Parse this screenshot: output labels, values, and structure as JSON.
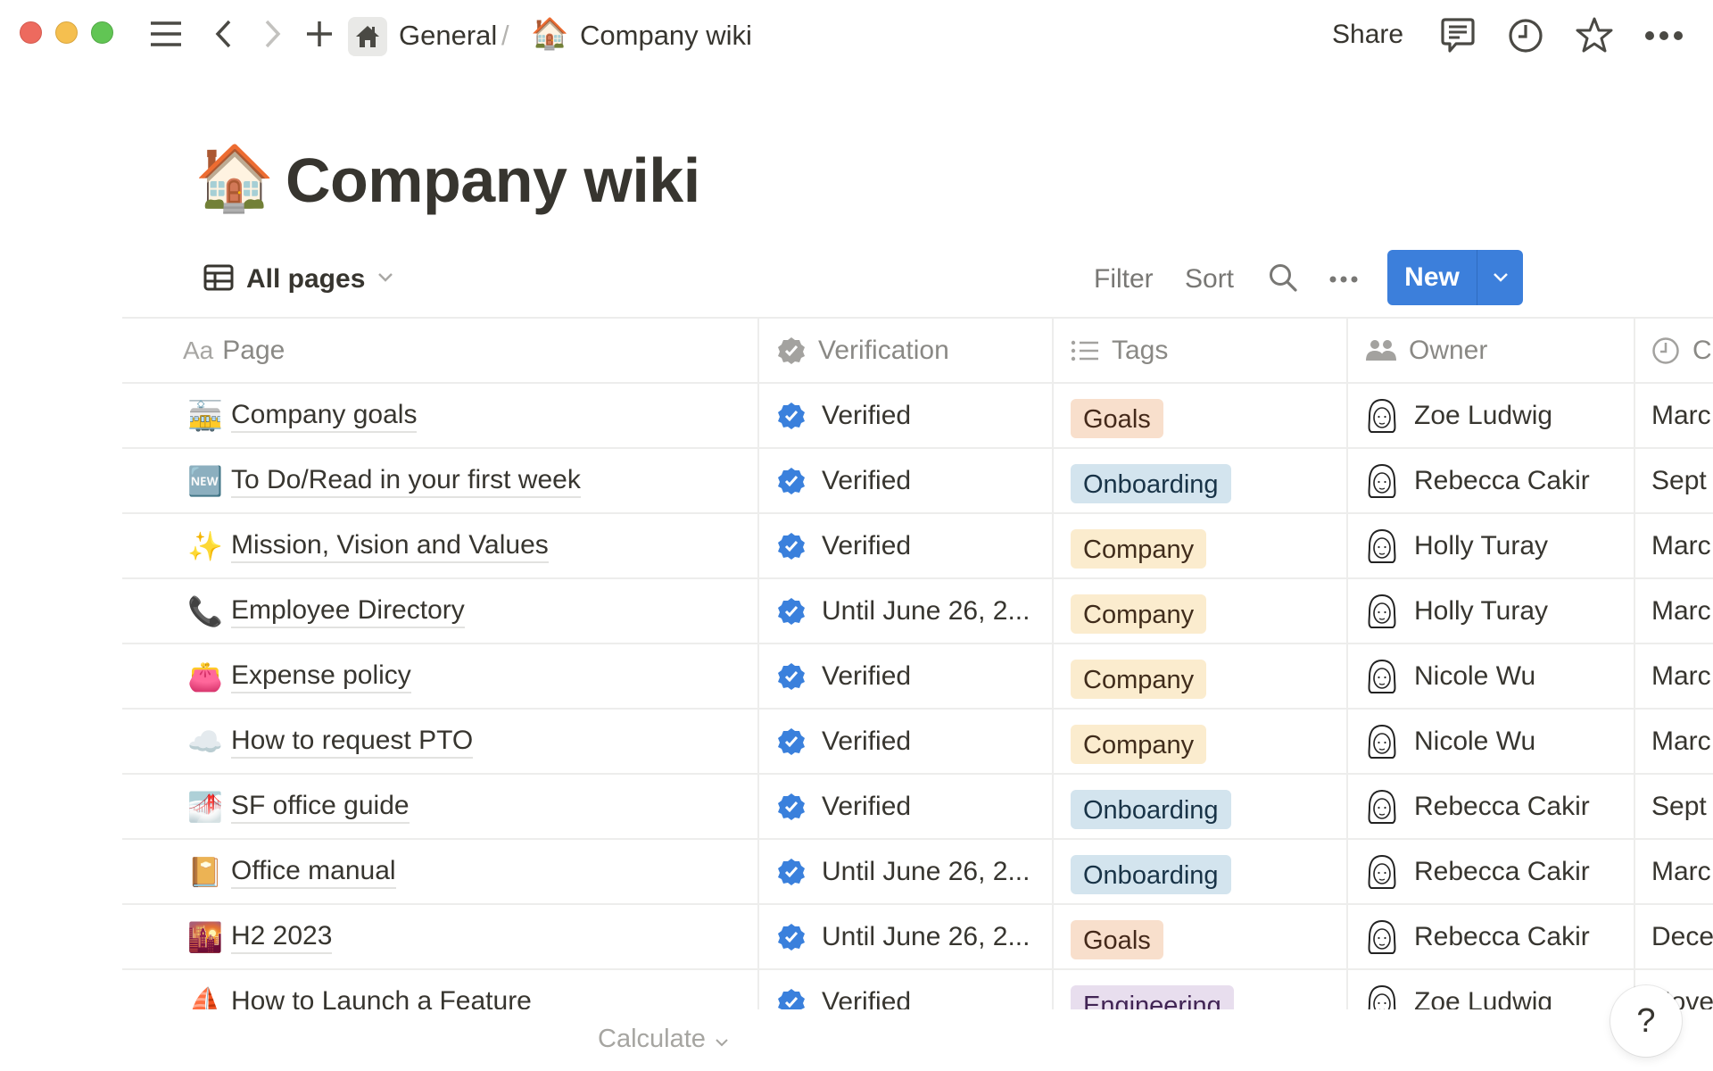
{
  "window": {
    "traffic_lights": [
      "close",
      "minimize",
      "zoom"
    ]
  },
  "topbar": {
    "breadcrumb": [
      {
        "label": "General",
        "icon": "home-icon"
      },
      {
        "label": "Company wiki",
        "emoji": "🏠"
      }
    ],
    "separator": "/",
    "share_label": "Share",
    "icons": [
      "menu-icon",
      "back-icon",
      "forward-icon",
      "plus-icon",
      "comment-icon",
      "clock-icon",
      "star-icon",
      "more-icon"
    ]
  },
  "page": {
    "emoji": "🏠",
    "title": "Company wiki"
  },
  "view": {
    "name": "All pages",
    "filter_label": "Filter",
    "sort_label": "Sort",
    "new_label": "New"
  },
  "table": {
    "columns": [
      {
        "label": "Page",
        "prefix": "Aa",
        "icon": "text-icon"
      },
      {
        "label": "Verification",
        "icon": "verified-badge-icon"
      },
      {
        "label": "Tags",
        "icon": "list-icon"
      },
      {
        "label": "Owner",
        "icon": "people-icon"
      },
      {
        "label": "C",
        "icon": "clock-icon"
      }
    ],
    "rows": [
      {
        "emoji": "🚋",
        "page": "Company goals",
        "verification": "Verified",
        "tag": "Goals",
        "owner": "Zoe Ludwig",
        "created": "Marc"
      },
      {
        "emoji": "🆕",
        "page": "To Do/Read in your first week",
        "verification": "Verified",
        "tag": "Onboarding",
        "owner": "Rebecca Cakir",
        "created": "Sept"
      },
      {
        "emoji": "✨",
        "page": "Mission, Vision and Values",
        "verification": "Verified",
        "tag": "Company",
        "owner": "Holly Turay",
        "created": "Marc"
      },
      {
        "emoji": "📞",
        "page": "Employee Directory",
        "verification": "Until June 26, 2...",
        "tag": "Company",
        "owner": "Holly Turay",
        "created": "Marc"
      },
      {
        "emoji": "👛",
        "page": "Expense policy",
        "verification": "Verified",
        "tag": "Company",
        "owner": "Nicole Wu",
        "created": "Marc"
      },
      {
        "emoji": "☁️",
        "page": "How to request PTO",
        "verification": "Verified",
        "tag": "Company",
        "owner": "Nicole Wu",
        "created": "Marc"
      },
      {
        "emoji": "🌁",
        "page": "SF office guide",
        "verification": "Verified",
        "tag": "Onboarding",
        "owner": "Rebecca Cakir",
        "created": "Sept"
      },
      {
        "emoji": "📔",
        "page": "Office manual",
        "verification": "Until June 26, 2...",
        "tag": "Onboarding",
        "owner": "Rebecca Cakir",
        "created": "Marc"
      },
      {
        "emoji": "🌇",
        "page": "H2 2023",
        "verification": "Until June 26, 2...",
        "tag": "Goals",
        "owner": "Rebecca Cakir",
        "created": "Dece"
      },
      {
        "emoji": "⛵",
        "page": "How to Launch a Feature",
        "verification": "Verified",
        "tag": "Engineering",
        "owner": "Zoe Ludwig",
        "created": "Nove"
      }
    ],
    "calculate_label": "Calculate"
  },
  "tag_colors": {
    "Goals": {
      "bg": "#f8dfcc",
      "fg": "#44291a"
    },
    "Onboarding": {
      "bg": "#d3e4ee",
      "fg": "#183347"
    },
    "Company": {
      "bg": "#fbecce",
      "fg": "#402c1b"
    },
    "Engineering": {
      "bg": "#e8deee",
      "fg": "#412454"
    }
  },
  "colors": {
    "accent": "#3c7fdb",
    "verified_badge": "#3a80dc",
    "header_badge": "#a3a29f"
  },
  "help": {
    "label": "?"
  }
}
